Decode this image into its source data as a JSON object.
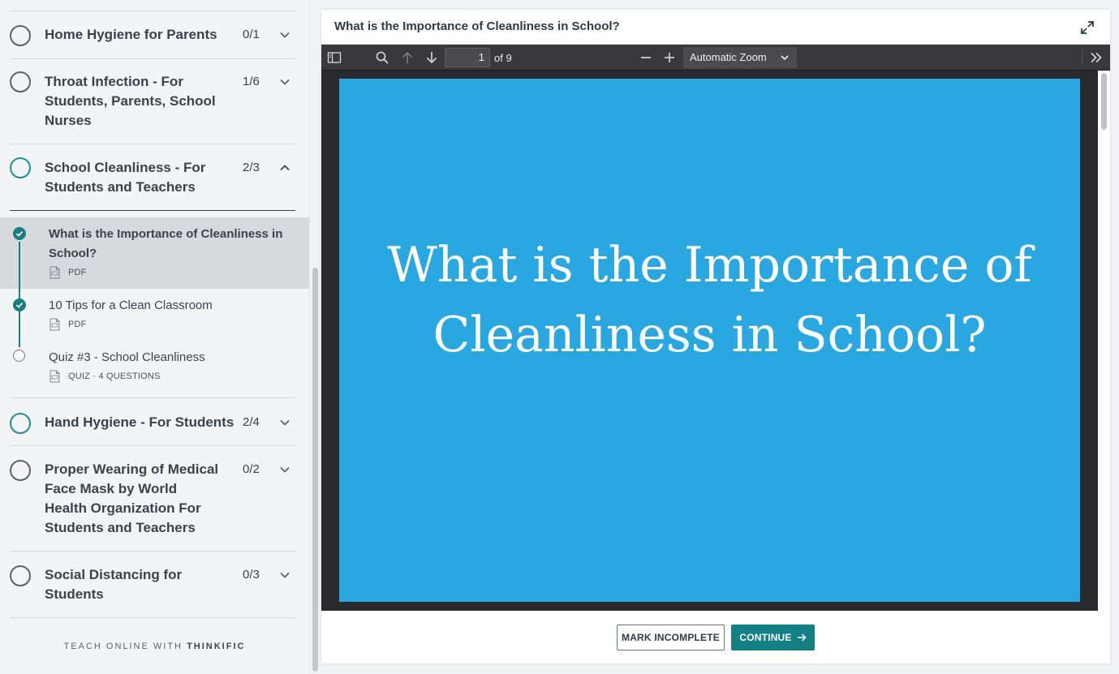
{
  "sidebar": {
    "chapters": [
      {
        "title": "Home Hygiene for Parents",
        "count": "0/1"
      },
      {
        "title": "Throat Infection - For Students, Parents, School Nurses",
        "count": "1/6"
      },
      {
        "title": "School Cleanliness - For Students and Teachers",
        "count": "2/3"
      },
      {
        "title": "Hand Hygiene - For Students",
        "count": "2/4"
      },
      {
        "title": "Proper Wearing of Medical Face Mask by World Health Organization For Students and Teachers",
        "count": "0/2"
      },
      {
        "title": "Social Distancing for Students",
        "count": "0/3"
      }
    ],
    "lessons": [
      {
        "title": "What is the Importance of Cleanliness in School?",
        "meta": "PDF"
      },
      {
        "title": "10 Tips for a Clean Classroom",
        "meta": "PDF"
      },
      {
        "title": "Quiz #3 - School Cleanliness",
        "meta": "QUIZ · 4 QUESTIONS"
      }
    ],
    "footer_prefix": "TEACH ONLINE WITH",
    "footer_brand": "THINKIFIC"
  },
  "main": {
    "title": "What is the Importance of Cleanliness in School?",
    "viewer": {
      "page_number": "1",
      "page_of": "of 9",
      "zoom": "Automatic Zoom",
      "heading": "What is the Importance of Cleanliness in School?"
    },
    "mark_incomplete_label": "MARK INCOMPLETE",
    "continue_label": "CONTINUE"
  },
  "colors": {
    "teal": "#138086",
    "slide_blue": "#29a7e1",
    "active_row": "#d8d9dc"
  }
}
